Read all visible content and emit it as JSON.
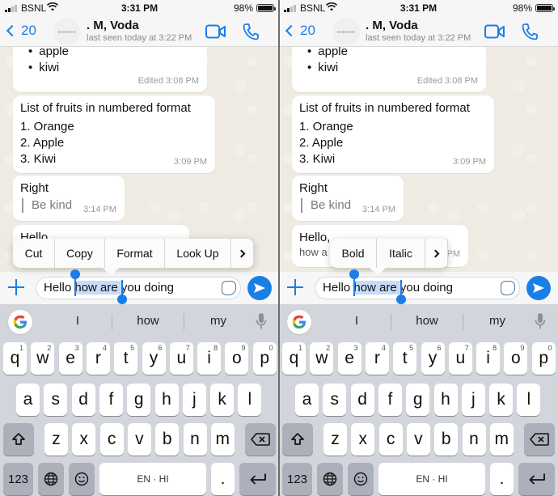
{
  "status_bar": {
    "carrier": "BSNL",
    "time": "3:31 PM",
    "battery": "98%"
  },
  "header": {
    "back_count": "20",
    "contact_name": ". M, Voda",
    "last_seen": "last seen today at 3:22 PM",
    "icons": {
      "back": "chevron-left-icon",
      "video": "video-camera-icon",
      "call": "phone-icon"
    }
  },
  "messages": {
    "bulleted": {
      "items": [
        "apple",
        "kiwi"
      ],
      "timestamp": "Edited 3:08 PM"
    },
    "numbered": {
      "title": "List of fruits in numbered format",
      "items": [
        "1. Orange",
        "2. Apple",
        "3. Kiwi"
      ],
      "timestamp": "3:09 PM"
    },
    "quote": {
      "text": "Right",
      "quote": "Be kind",
      "timestamp": "3:14 PM"
    },
    "hello": {
      "text_left": "Hello",
      "text_right": "Hello,",
      "sub_right": "how a",
      "timestamp_partial": "PM"
    }
  },
  "left_panel": {
    "edit_menu": [
      "Cut",
      "Copy",
      "Format",
      "Look Up"
    ]
  },
  "right_panel": {
    "format_menu": [
      "Bold",
      "Italic"
    ]
  },
  "input": {
    "before": "Hello ",
    "selected": "how are ",
    "after": "you doing",
    "icons": {
      "attach": "plus-icon",
      "sticker": "sticker-icon",
      "send": "send-icon"
    }
  },
  "keyboard": {
    "suggestions": [
      "I",
      "how",
      "my"
    ],
    "row1": [
      {
        "k": "q",
        "n": "1"
      },
      {
        "k": "w",
        "n": "2"
      },
      {
        "k": "e",
        "n": "3"
      },
      {
        "k": "r",
        "n": "4"
      },
      {
        "k": "t",
        "n": "5"
      },
      {
        "k": "y",
        "n": "6"
      },
      {
        "k": "u",
        "n": "7"
      },
      {
        "k": "i",
        "n": "8"
      },
      {
        "k": "o",
        "n": "9"
      },
      {
        "k": "p",
        "n": "0"
      }
    ],
    "row2": [
      "a",
      "s",
      "d",
      "f",
      "g",
      "h",
      "j",
      "k",
      "l"
    ],
    "row3": [
      "z",
      "x",
      "c",
      "v",
      "b",
      "n",
      "m"
    ],
    "numbers_key": "123",
    "space_label": "EN · HI",
    "period": ".",
    "google_logo": "G"
  }
}
